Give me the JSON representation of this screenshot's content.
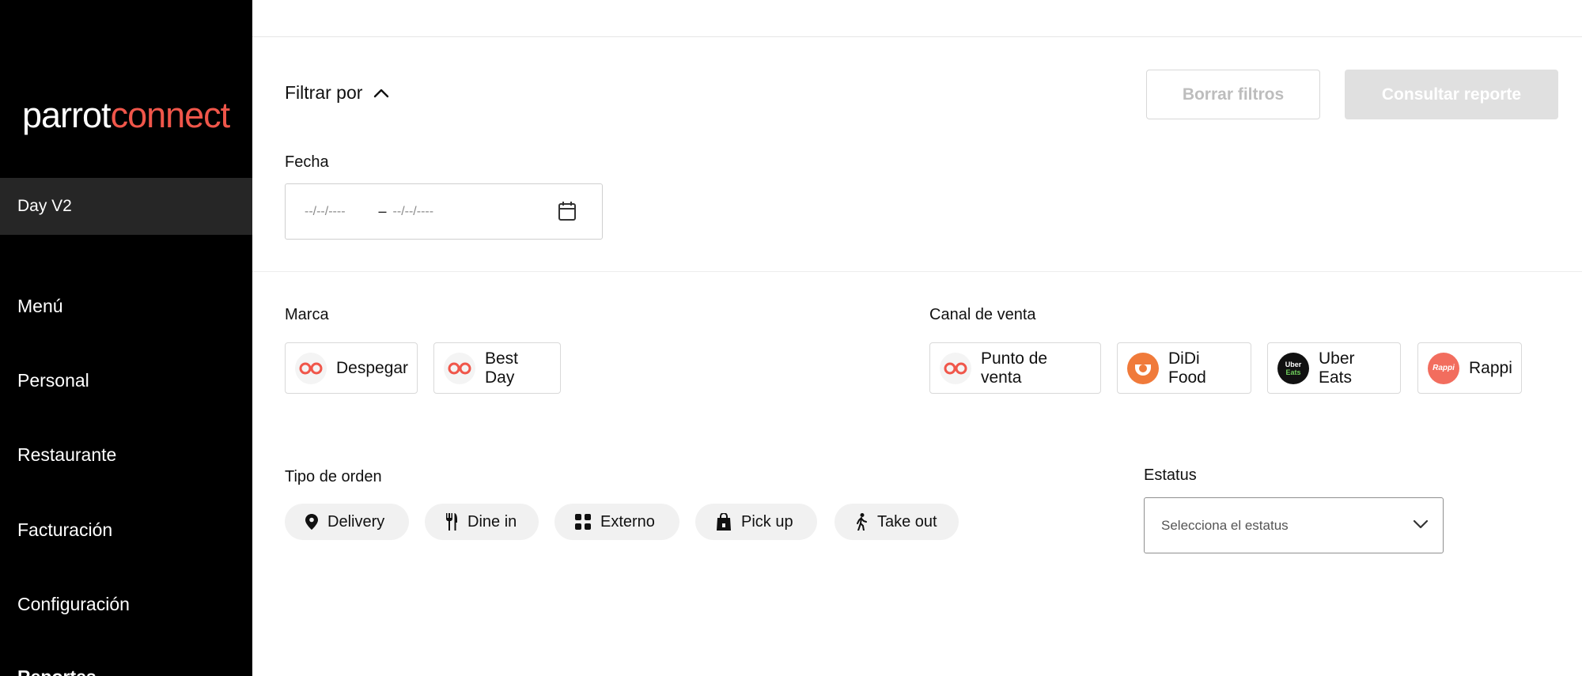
{
  "sidebar": {
    "logo_part1": "parrot",
    "logo_part2": "connect",
    "store": "Day V2",
    "nav": [
      "Menú",
      "Personal",
      "Restaurante",
      "Facturación",
      "Configuración",
      "Reportes"
    ]
  },
  "filters": {
    "toggle_label": "Filtrar por",
    "clear_label": "Borrar filtros",
    "report_label": "Consultar reporte",
    "date": {
      "label": "Fecha",
      "start_placeholder": "--/--/----",
      "separator": "–",
      "end_placeholder": "--/--/----"
    },
    "brand": {
      "label": "Marca",
      "items": [
        "Despegar",
        "Best Day"
      ]
    },
    "channel": {
      "label": "Canal de venta",
      "items": [
        "Punto de venta",
        "DiDi Food",
        "Uber Eats",
        "Rappi"
      ],
      "uber_icon_top": "Uber",
      "uber_icon_bottom": "Eats",
      "rappi_icon": "Rappi"
    },
    "order_type": {
      "label": "Tipo de orden",
      "items": [
        "Delivery",
        "Dine in",
        "Externo",
        "Pick up",
        "Take out"
      ]
    },
    "status": {
      "label": "Estatus",
      "placeholder": "Selecciona el estatus"
    }
  },
  "colors": {
    "brand_accent": "#f0564a",
    "didi": "#f07a3a",
    "uber_bg": "#111111",
    "uber_accent": "#6fcf5c",
    "rappi": "#f26d5e",
    "sidebar_bg": "#000000",
    "pill_bg": "#f1f1f1"
  }
}
